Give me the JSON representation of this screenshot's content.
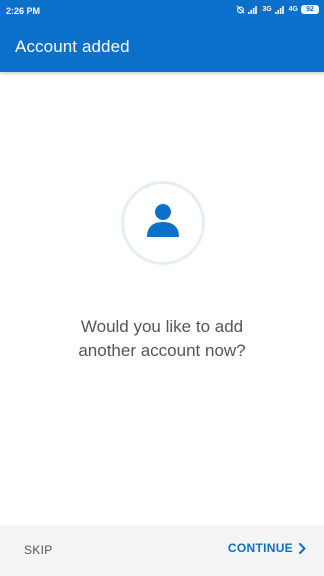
{
  "status_bar": {
    "time": "2:26 PM",
    "network_1": "3G",
    "network_2": "4G",
    "battery": "92"
  },
  "header": {
    "title": "Account added"
  },
  "main": {
    "prompt_line_1": "Would you like to add",
    "prompt_line_2": "another account now?",
    "avatar_icon": "person-icon"
  },
  "footer": {
    "skip_label": "SKIP",
    "continue_label": "CONTINUE",
    "continue_icon": "chevron-right-icon"
  },
  "colors": {
    "brand": "#0a70c9",
    "avatar_ring": "#e3eef7",
    "body_text": "#555555",
    "footer_bg": "#f4f4f4"
  }
}
